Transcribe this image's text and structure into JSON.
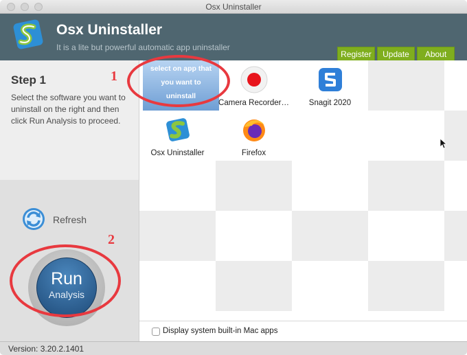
{
  "window": {
    "title": "Osx Uninstaller"
  },
  "header": {
    "app_name": "Osx Uninstaller",
    "tagline": "It is a lite but powerful automatic app uninstaller",
    "buttons": [
      "Register",
      "Update",
      "About"
    ]
  },
  "step": {
    "title": "Step 1",
    "description": "Select the software you want to uninstall on the right and then click Run Analysis to proceed."
  },
  "actions": {
    "refresh_label": "Refresh",
    "run_label": "Run",
    "run_sublabel": "Analysis"
  },
  "apps": {
    "select_hint": "select on app that you want to uninstall",
    "items": [
      "Camera Recorder…",
      "Snagit 2020",
      "Osx Uninstaller",
      "Firefox"
    ]
  },
  "filter": {
    "label": "Display system built-in Mac apps",
    "checked": false
  },
  "status": {
    "version": "Version: 3.20.2.1401"
  },
  "annotations": [
    "1",
    "2"
  ],
  "colors": {
    "header_bg": "#4f6670",
    "button_green": "#7fae1e",
    "annotation_red": "#e8393f"
  }
}
